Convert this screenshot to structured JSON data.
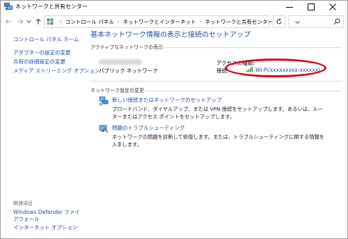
{
  "window": {
    "title": "ネットワークと共有センター"
  },
  "address": {
    "crumbs": [
      "コントロール パネル",
      "ネットワークとインターネット",
      "ネットワークと共有センター"
    ]
  },
  "left_pane": {
    "home": "コントロール パネル ホーム",
    "links": [
      "アダプターの設定の変更",
      "共有の詳細設定の変更",
      "メディア ストリーミング オプション"
    ],
    "related_heading": "関連項目",
    "related_links": [
      "Windows Defender ファイアウォール",
      "インターネット オプション"
    ]
  },
  "main": {
    "title": "基本ネットワーク情報の表示と接続のセットアップ",
    "active_networks_label": "アクティブなネットワークの表示",
    "network_type": "パブリック ネットワーク",
    "access_type_label": "アクセスの種類:",
    "connection_label": "接続:",
    "connection_value": "Wi-Fi(xxxxxxxxx-xxxxxx)",
    "change_settings_label": "ネットワーク設定の変更",
    "tasks": [
      {
        "title": "新しい接続またはネットワークのセットアップ",
        "desc": "ブロードバンド、ダイヤルアップ、または VPN 接続をセットアップします。あるいは、ルーターまたはアクセス ポイントをセットアップします。"
      },
      {
        "title": "問題のトラブルシューティング",
        "desc": "ネットワークの問題を診断して修復します。または、トラブルシューティングに関する情報を入手します。"
      }
    ]
  },
  "colors": {
    "link": "#1a50a8",
    "title": "#1e4e9e",
    "highlight": "#e0001b"
  }
}
